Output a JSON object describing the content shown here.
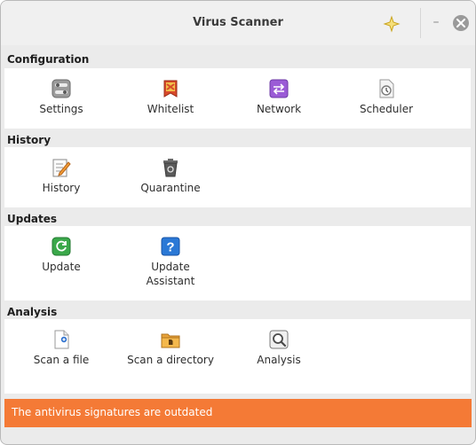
{
  "window": {
    "title": "Virus Scanner"
  },
  "titlebar": {
    "minimize_label": "–"
  },
  "sections": {
    "configuration": {
      "title": "Configuration",
      "items": [
        {
          "label": "Settings",
          "icon": "settings-icon"
        },
        {
          "label": "Whitelist",
          "icon": "whitelist-icon"
        },
        {
          "label": "Network",
          "icon": "network-icon"
        },
        {
          "label": "Scheduler",
          "icon": "scheduler-icon"
        }
      ]
    },
    "history": {
      "title": "History",
      "items": [
        {
          "label": "History",
          "icon": "history-icon"
        },
        {
          "label": "Quarantine",
          "icon": "quarantine-icon"
        }
      ]
    },
    "updates": {
      "title": "Updates",
      "items": [
        {
          "label": "Update",
          "icon": "update-icon"
        },
        {
          "label": "Update\nAssistant",
          "icon": "help-icon"
        }
      ]
    },
    "analysis": {
      "title": "Analysis",
      "items": [
        {
          "label": "Scan a file",
          "icon": "scan-file-icon"
        },
        {
          "label": "Scan a directory",
          "icon": "scan-directory-icon"
        },
        {
          "label": "Analysis",
          "icon": "analysis-icon"
        }
      ]
    }
  },
  "status": {
    "message": "The antivirus signatures are outdated",
    "color": "#f47a36"
  }
}
